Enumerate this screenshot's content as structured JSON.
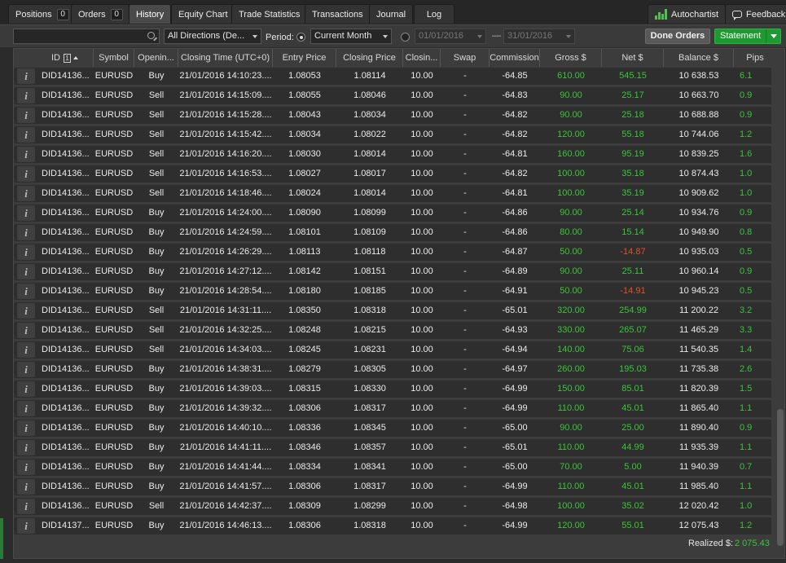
{
  "tabs": [
    {
      "label": "Positions",
      "badge": "0"
    },
    {
      "label": "Orders",
      "badge": "0"
    },
    {
      "label": "History"
    },
    {
      "label": "Equity Chart"
    },
    {
      "label": "Trade Statistics"
    },
    {
      "label": "Transactions"
    },
    {
      "label": "Journal"
    },
    {
      "label": "Log"
    }
  ],
  "right_tabs": {
    "autochartist": "Autochartist",
    "feedback": "Feedback"
  },
  "filters": {
    "search_value": "",
    "direction": "All Directions (De...",
    "period_label": "Period:",
    "period_value": "Current Month",
    "date_from": "01/01/2016",
    "date_to": "31/01/2016",
    "done_orders": "Done Orders",
    "statement": "Statement"
  },
  "columns": [
    "ID",
    "Symbol",
    "Openin...",
    "Closing Time (UTC+0)",
    "Entry Price",
    "Closing Price",
    "Closin...",
    "Swap",
    "Commission",
    "Gross $",
    "Net $",
    "Balance $",
    "Pips"
  ],
  "sort_indicator": "1",
  "rows": [
    {
      "id": "DID14136...",
      "symbol": "EURUSD",
      "dir": "Buy",
      "time": "21/01/2016 14:10:23....",
      "entry": "1.08053",
      "close": "1.08114",
      "vol": "10.00",
      "swap": "-",
      "comm": "-64.85",
      "gross": "610.00",
      "net": "545.15",
      "balance": "10 638.53",
      "pips": "6.1",
      "net_neg": false
    },
    {
      "id": "DID14136...",
      "symbol": "EURUSD",
      "dir": "Sell",
      "time": "21/01/2016 14:15:09....",
      "entry": "1.08055",
      "close": "1.08046",
      "vol": "10.00",
      "swap": "-",
      "comm": "-64.83",
      "gross": "90.00",
      "net": "25.17",
      "balance": "10 663.70",
      "pips": "0.9",
      "net_neg": false
    },
    {
      "id": "DID14136...",
      "symbol": "EURUSD",
      "dir": "Sell",
      "time": "21/01/2016 14:15:28....",
      "entry": "1.08043",
      "close": "1.08034",
      "vol": "10.00",
      "swap": "-",
      "comm": "-64.82",
      "gross": "90.00",
      "net": "25.18",
      "balance": "10 688.88",
      "pips": "0.9",
      "net_neg": false
    },
    {
      "id": "DID14136...",
      "symbol": "EURUSD",
      "dir": "Sell",
      "time": "21/01/2016 14:15:42....",
      "entry": "1.08034",
      "close": "1.08022",
      "vol": "10.00",
      "swap": "-",
      "comm": "-64.82",
      "gross": "120.00",
      "net": "55.18",
      "balance": "10 744.06",
      "pips": "1.2",
      "net_neg": false
    },
    {
      "id": "DID14136...",
      "symbol": "EURUSD",
      "dir": "Sell",
      "time": "21/01/2016 14:16:20....",
      "entry": "1.08030",
      "close": "1.08014",
      "vol": "10.00",
      "swap": "-",
      "comm": "-64.81",
      "gross": "160.00",
      "net": "95.19",
      "balance": "10 839.25",
      "pips": "1.6",
      "net_neg": false
    },
    {
      "id": "DID14136...",
      "symbol": "EURUSD",
      "dir": "Sell",
      "time": "21/01/2016 14:16:53....",
      "entry": "1.08027",
      "close": "1.08017",
      "vol": "10.00",
      "swap": "-",
      "comm": "-64.82",
      "gross": "100.00",
      "net": "35.18",
      "balance": "10 874.43",
      "pips": "1.0",
      "net_neg": false
    },
    {
      "id": "DID14136...",
      "symbol": "EURUSD",
      "dir": "Sell",
      "time": "21/01/2016 14:18:46....",
      "entry": "1.08024",
      "close": "1.08014",
      "vol": "10.00",
      "swap": "-",
      "comm": "-64.81",
      "gross": "100.00",
      "net": "35.19",
      "balance": "10 909.62",
      "pips": "1.0",
      "net_neg": false
    },
    {
      "id": "DID14136...",
      "symbol": "EURUSD",
      "dir": "Buy",
      "time": "21/01/2016 14:24:00....",
      "entry": "1.08090",
      "close": "1.08099",
      "vol": "10.00",
      "swap": "-",
      "comm": "-64.86",
      "gross": "90.00",
      "net": "25.14",
      "balance": "10 934.76",
      "pips": "0.9",
      "net_neg": false
    },
    {
      "id": "DID14136...",
      "symbol": "EURUSD",
      "dir": "Buy",
      "time": "21/01/2016 14:24:59....",
      "entry": "1.08101",
      "close": "1.08109",
      "vol": "10.00",
      "swap": "-",
      "comm": "-64.86",
      "gross": "80.00",
      "net": "15.14",
      "balance": "10 949.90",
      "pips": "0.8",
      "net_neg": false
    },
    {
      "id": "DID14136...",
      "symbol": "EURUSD",
      "dir": "Buy",
      "time": "21/01/2016 14:26:29....",
      "entry": "1.08113",
      "close": "1.08118",
      "vol": "10.00",
      "swap": "-",
      "comm": "-64.87",
      "gross": "50.00",
      "net": "-14.87",
      "balance": "10 935.03",
      "pips": "0.5",
      "net_neg": true
    },
    {
      "id": "DID14136...",
      "symbol": "EURUSD",
      "dir": "Buy",
      "time": "21/01/2016 14:27:12....",
      "entry": "1.08142",
      "close": "1.08151",
      "vol": "10.00",
      "swap": "-",
      "comm": "-64.89",
      "gross": "90.00",
      "net": "25.11",
      "balance": "10 960.14",
      "pips": "0.9",
      "net_neg": false
    },
    {
      "id": "DID14136...",
      "symbol": "EURUSD",
      "dir": "Buy",
      "time": "21/01/2016 14:28:54....",
      "entry": "1.08180",
      "close": "1.08185",
      "vol": "10.00",
      "swap": "-",
      "comm": "-64.91",
      "gross": "50.00",
      "net": "-14.91",
      "balance": "10 945.23",
      "pips": "0.5",
      "net_neg": true
    },
    {
      "id": "DID14136...",
      "symbol": "EURUSD",
      "dir": "Sell",
      "time": "21/01/2016 14:31:11....",
      "entry": "1.08350",
      "close": "1.08318",
      "vol": "10.00",
      "swap": "-",
      "comm": "-65.01",
      "gross": "320.00",
      "net": "254.99",
      "balance": "11 200.22",
      "pips": "3.2",
      "net_neg": false
    },
    {
      "id": "DID14136...",
      "symbol": "EURUSD",
      "dir": "Sell",
      "time": "21/01/2016 14:32:25....",
      "entry": "1.08248",
      "close": "1.08215",
      "vol": "10.00",
      "swap": "-",
      "comm": "-64.93",
      "gross": "330.00",
      "net": "265.07",
      "balance": "11 465.29",
      "pips": "3.3",
      "net_neg": false
    },
    {
      "id": "DID14136...",
      "symbol": "EURUSD",
      "dir": "Sell",
      "time": "21/01/2016 14:34:03....",
      "entry": "1.08245",
      "close": "1.08231",
      "vol": "10.00",
      "swap": "-",
      "comm": "-64.94",
      "gross": "140.00",
      "net": "75.06",
      "balance": "11 540.35",
      "pips": "1.4",
      "net_neg": false
    },
    {
      "id": "DID14136...",
      "symbol": "EURUSD",
      "dir": "Buy",
      "time": "21/01/2016 14:38:31....",
      "entry": "1.08279",
      "close": "1.08305",
      "vol": "10.00",
      "swap": "-",
      "comm": "-64.97",
      "gross": "260.00",
      "net": "195.03",
      "balance": "11 735.38",
      "pips": "2.6",
      "net_neg": false
    },
    {
      "id": "DID14136...",
      "symbol": "EURUSD",
      "dir": "Buy",
      "time": "21/01/2016 14:39:03....",
      "entry": "1.08315",
      "close": "1.08330",
      "vol": "10.00",
      "swap": "-",
      "comm": "-64.99",
      "gross": "150.00",
      "net": "85.01",
      "balance": "11 820.39",
      "pips": "1.5",
      "net_neg": false
    },
    {
      "id": "DID14136...",
      "symbol": "EURUSD",
      "dir": "Buy",
      "time": "21/01/2016 14:39:32....",
      "entry": "1.08306",
      "close": "1.08317",
      "vol": "10.00",
      "swap": "-",
      "comm": "-64.99",
      "gross": "110.00",
      "net": "45.01",
      "balance": "11 865.40",
      "pips": "1.1",
      "net_neg": false
    },
    {
      "id": "DID14136...",
      "symbol": "EURUSD",
      "dir": "Buy",
      "time": "21/01/2016 14:40:10....",
      "entry": "1.08336",
      "close": "1.08345",
      "vol": "10.00",
      "swap": "-",
      "comm": "-65.00",
      "gross": "90.00",
      "net": "25.00",
      "balance": "11 890.40",
      "pips": "0.9",
      "net_neg": false
    },
    {
      "id": "DID14136...",
      "symbol": "EURUSD",
      "dir": "Buy",
      "time": "21/01/2016 14:41:11....",
      "entry": "1.08346",
      "close": "1.08357",
      "vol": "10.00",
      "swap": "-",
      "comm": "-65.01",
      "gross": "110.00",
      "net": "44.99",
      "balance": "11 935.39",
      "pips": "1.1",
      "net_neg": false
    },
    {
      "id": "DID14136...",
      "symbol": "EURUSD",
      "dir": "Buy",
      "time": "21/01/2016 14:41:44....",
      "entry": "1.08334",
      "close": "1.08341",
      "vol": "10.00",
      "swap": "-",
      "comm": "-65.00",
      "gross": "70.00",
      "net": "5.00",
      "balance": "11 940.39",
      "pips": "0.7",
      "net_neg": false
    },
    {
      "id": "DID14136...",
      "symbol": "EURUSD",
      "dir": "Buy",
      "time": "21/01/2016 14:41:57....",
      "entry": "1.08306",
      "close": "1.08317",
      "vol": "10.00",
      "swap": "-",
      "comm": "-64.99",
      "gross": "110.00",
      "net": "45.01",
      "balance": "11 985.40",
      "pips": "1.1",
      "net_neg": false
    },
    {
      "id": "DID14136...",
      "symbol": "EURUSD",
      "dir": "Sell",
      "time": "21/01/2016 14:42:37....",
      "entry": "1.08309",
      "close": "1.08299",
      "vol": "10.00",
      "swap": "-",
      "comm": "-64.98",
      "gross": "100.00",
      "net": "35.02",
      "balance": "12 020.42",
      "pips": "1.0",
      "net_neg": false
    },
    {
      "id": "DID14137...",
      "symbol": "EURUSD",
      "dir": "Buy",
      "time": "21/01/2016 14:46:13....",
      "entry": "1.08306",
      "close": "1.08318",
      "vol": "10.00",
      "swap": "-",
      "comm": "-64.99",
      "gross": "120.00",
      "net": "55.01",
      "balance": "12 075.43",
      "pips": "1.2",
      "net_neg": false
    }
  ],
  "realized": {
    "label": "Realized $:",
    "value": "2 075.43"
  },
  "colors": {
    "positive": "#3cc43c",
    "negative": "#e0522a",
    "accent": "#1f9a33"
  }
}
